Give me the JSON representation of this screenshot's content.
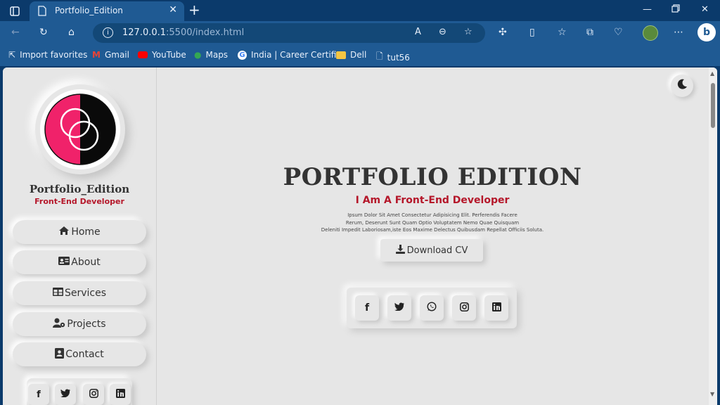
{
  "browser": {
    "tab_title": "Portfolio_Edition",
    "url_host": "127.0.0.1",
    "url_rest": ":5500/index.html",
    "bookmarks": [
      {
        "label": "Import favorites"
      },
      {
        "label": "Gmail"
      },
      {
        "label": "YouTube"
      },
      {
        "label": "Maps"
      },
      {
        "label": "India | Career Certifi..."
      },
      {
        "label": "Dell"
      },
      {
        "label": "tut56"
      }
    ]
  },
  "sidebar": {
    "name": "Portfolio_Edition",
    "role": "Front-End Developer",
    "nav": [
      {
        "label": "Home",
        "icon": "home-icon"
      },
      {
        "label": "About",
        "icon": "id-card-icon"
      },
      {
        "label": "Services",
        "icon": "table-icon"
      },
      {
        "label": "Projects",
        "icon": "user-gear-icon"
      },
      {
        "label": "Contact",
        "icon": "contact-icon"
      }
    ],
    "social": [
      {
        "icon": "facebook-icon",
        "glyph": "f"
      },
      {
        "icon": "twitter-icon",
        "glyph": "🐦"
      },
      {
        "icon": "instagram-icon",
        "glyph": "◎"
      },
      {
        "icon": "linkedin-icon",
        "glyph": "in"
      }
    ]
  },
  "hero": {
    "title": "PORTFOLIO EDITION",
    "subtitle": "I Am A Front-End Developer",
    "desc_line1": "Ipsum Dolor Sit Amet Consectetur Adipisicing Elit. Perferendis Facere",
    "desc_line2": "Rerum, Deserunt Sunt Quam Optio Voluptatem Nemo Quae Quisquam",
    "desc_line3": "Deleniti Impedit Laboriosam,iste Eos Maxime Delectus Quibusdam Repellat Officiis Soluta.",
    "cv_button": "Download CV",
    "social": [
      {
        "icon": "facebook-icon",
        "glyph": "f"
      },
      {
        "icon": "twitter-icon",
        "glyph": "🐦"
      },
      {
        "icon": "whatsapp-icon",
        "glyph": "✆"
      },
      {
        "icon": "instagram-icon",
        "glyph": "◎"
      },
      {
        "icon": "linkedin-icon",
        "glyph": "in"
      }
    ]
  },
  "colors": {
    "accent": "#b5172a",
    "logo_pink": "#f0226a",
    "background": "#e6e6e6",
    "browser_chrome": "#1f5a93"
  }
}
